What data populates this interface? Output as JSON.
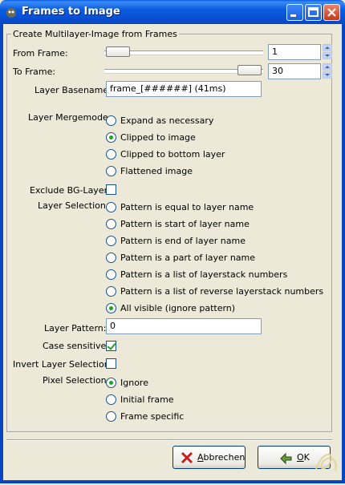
{
  "window": {
    "title": "Frames to Image",
    "controls": [
      "minimize-icon",
      "maximize-icon",
      "close-icon"
    ]
  },
  "frame_title": "Create Multilayer-Image from Frames",
  "from_frame": {
    "label": "From Frame:",
    "value": "1",
    "slider_fraction": 0.0
  },
  "to_frame": {
    "label": "To Frame:",
    "value": "30",
    "slider_fraction": 1.0
  },
  "layer_basename": {
    "label": "Layer Basename:",
    "value": "frame_[######] (41ms)"
  },
  "layer_mergemode": {
    "label": "Layer Mergemode:",
    "options": [
      "Expand as necessary",
      "Clipped to image",
      "Clipped to bottom layer",
      "Flattened image"
    ],
    "selected_index": 1
  },
  "exclude_bg": {
    "label": "Exclude BG-Layer:",
    "checked": false
  },
  "layer_selection": {
    "label": "Layer Selection:",
    "options": [
      "Pattern is equal to layer name",
      "Pattern is start of layer name",
      "Pattern is end of layer name",
      "Pattern is a part of layer name",
      "Pattern is a list of layerstack numbers",
      "Pattern is a list of reverse layerstack numbers",
      "All visible (ignore pattern)"
    ],
    "selected_index": 6
  },
  "layer_pattern": {
    "label": "Layer Pattern:",
    "value": "0"
  },
  "case_sensitive": {
    "label": "Case sensitive:",
    "checked": true
  },
  "invert_selection": {
    "label": "Invert Layer Selection:",
    "checked": false
  },
  "pixel_selection": {
    "label": "Pixel Selection:",
    "options": [
      "Ignore",
      "Initial frame",
      "Frame specific"
    ],
    "selected_index": 0
  },
  "buttons": {
    "cancel": {
      "mnemonic": "A",
      "rest": "bbrechen",
      "icon": "cancel-x-icon"
    },
    "ok": {
      "mnemonic": "O",
      "rest": "K",
      "icon": "ok-arrow-icon"
    }
  },
  "colors": {
    "titlebar": "#0a5ce0",
    "radio_dot": "#21a121",
    "window_bg": "#ece9d8"
  }
}
